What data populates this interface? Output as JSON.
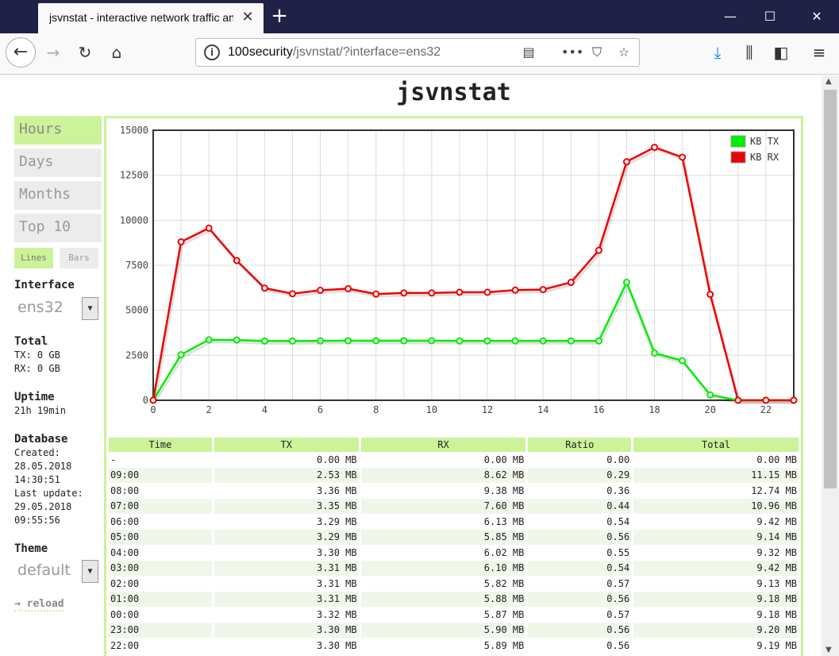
{
  "browser": {
    "tab_title": "jsvnstat - interactive network traffic analysis",
    "tab_close": "✕",
    "new_tab": "+",
    "url_host": "100security",
    "url_path": "/jsvnstat/?interface=ens32"
  },
  "page": {
    "title": "jsvnstat",
    "menu": [
      "Hours",
      "Days",
      "Months",
      "Top 10"
    ],
    "active_menu": "Hours",
    "chart_modes": [
      "Lines",
      "Bars"
    ],
    "active_mode": "Lines",
    "interface_label": "Interface",
    "interface_value": "ens32",
    "total_label": "Total",
    "total_tx": "TX: 0 GB",
    "total_rx": "RX: 0 GB",
    "uptime_label": "Uptime",
    "uptime_value": "21h 19min",
    "database_label": "Database",
    "db_created_label": "Created:",
    "db_created_date": "28.05.2018",
    "db_created_time": "14:30:51",
    "db_updated_label": "Last update:",
    "db_updated_date": "29.05.2018",
    "db_updated_time": "09:55:56",
    "theme_label": "Theme",
    "theme_value": "default",
    "reload_label": "→ reload"
  },
  "chart_data": {
    "type": "line",
    "x": [
      0,
      1,
      2,
      3,
      4,
      5,
      6,
      7,
      8,
      9,
      10,
      11,
      12,
      13,
      14,
      15,
      16,
      17,
      18,
      19,
      20,
      21,
      22,
      23
    ],
    "series": [
      {
        "name": "KB TX",
        "color": "#00ee00",
        "values": [
          0,
          2530,
          3360,
          3350,
          3290,
          3290,
          3300,
          3310,
          3310,
          3310,
          3310,
          3300,
          3300,
          3300,
          3300,
          3300,
          3300,
          6550,
          2620,
          2200,
          300,
          0,
          0,
          0
        ]
      },
      {
        "name": "KB RX",
        "color": "#ee0000",
        "values": [
          0,
          8800,
          9560,
          7760,
          6230,
          5920,
          6110,
          6200,
          5900,
          5960,
          5960,
          6000,
          6000,
          6120,
          6150,
          6550,
          8330,
          13250,
          14050,
          13500,
          5880,
          0,
          0,
          0
        ]
      }
    ],
    "xticks": [
      0,
      2,
      4,
      6,
      8,
      10,
      12,
      14,
      16,
      18,
      20,
      22
    ],
    "yticks": [
      0,
      2500,
      5000,
      7500,
      10000,
      12500,
      15000
    ],
    "ylim": [
      0,
      15000
    ],
    "xlim": [
      0,
      23
    ],
    "grid": true,
    "legend_position": "top-right"
  },
  "table": {
    "headers": [
      "Time",
      "TX",
      "RX",
      "Ratio",
      "Total"
    ],
    "rows": [
      [
        "-",
        "0.00 MB",
        "0.00 MB",
        "0.00",
        "0.00 MB"
      ],
      [
        "09:00",
        "2.53 MB",
        "8.62 MB",
        "0.29",
        "11.15 MB"
      ],
      [
        "08:00",
        "3.36 MB",
        "9.38 MB",
        "0.36",
        "12.74 MB"
      ],
      [
        "07:00",
        "3.35 MB",
        "7.60 MB",
        "0.44",
        "10.96 MB"
      ],
      [
        "06:00",
        "3.29 MB",
        "6.13 MB",
        "0.54",
        "9.42 MB"
      ],
      [
        "05:00",
        "3.29 MB",
        "5.85 MB",
        "0.56",
        "9.14 MB"
      ],
      [
        "04:00",
        "3.30 MB",
        "6.02 MB",
        "0.55",
        "9.32 MB"
      ],
      [
        "03:00",
        "3.31 MB",
        "6.10 MB",
        "0.54",
        "9.42 MB"
      ],
      [
        "02:00",
        "3.31 MB",
        "5.82 MB",
        "0.57",
        "9.13 MB"
      ],
      [
        "01:00",
        "3.31 MB",
        "5.88 MB",
        "0.56",
        "9.18 MB"
      ],
      [
        "00:00",
        "3.32 MB",
        "5.87 MB",
        "0.57",
        "9.18 MB"
      ],
      [
        "23:00",
        "3.30 MB",
        "5.90 MB",
        "0.56",
        "9.20 MB"
      ],
      [
        "22:00",
        "3.30 MB",
        "5.89 MB",
        "0.56",
        "9.19 MB"
      ]
    ]
  }
}
